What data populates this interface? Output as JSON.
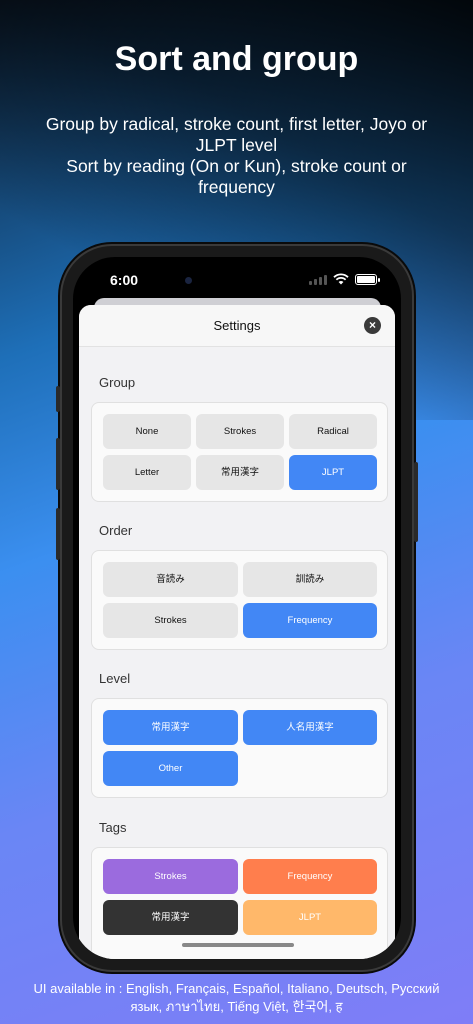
{
  "headline": "Sort and group",
  "subline": [
    "Group by radical, stroke count, first letter, Joyo or JLPT level",
    "Sort by reading (On or Kun), stroke count or frequency"
  ],
  "footer": [
    "UI available in : English, Français, Español, Italiano, Deutsch, Русский",
    "язык, ภาษาไทย, Tiếng Việt, 한국어, ह"
  ],
  "status": {
    "time": "6:00"
  },
  "settings": {
    "title": "Settings",
    "close_icon": "×",
    "group": {
      "label": "Group",
      "options": [
        "None",
        "Strokes",
        "Radical",
        "Letter",
        "常用漢字",
        "JLPT"
      ],
      "selected": "JLPT"
    },
    "order": {
      "label": "Order",
      "options": [
        "音読み",
        "訓読み",
        "Strokes",
        "Frequency"
      ],
      "selected": "Frequency"
    },
    "level": {
      "label": "Level",
      "options": [
        "常用漢字",
        "人名用漢字",
        "Other"
      ],
      "selected": [
        "常用漢字",
        "人名用漢字",
        "Other"
      ]
    },
    "tags": {
      "label": "Tags",
      "options": [
        "Strokes",
        "Frequency",
        "常用漢字",
        "JLPT"
      ],
      "colors": [
        "#9b6bde",
        "#ff7e4d",
        "#333333",
        "#ffb86a"
      ]
    }
  },
  "colors": {
    "accent": "#4287f5"
  }
}
